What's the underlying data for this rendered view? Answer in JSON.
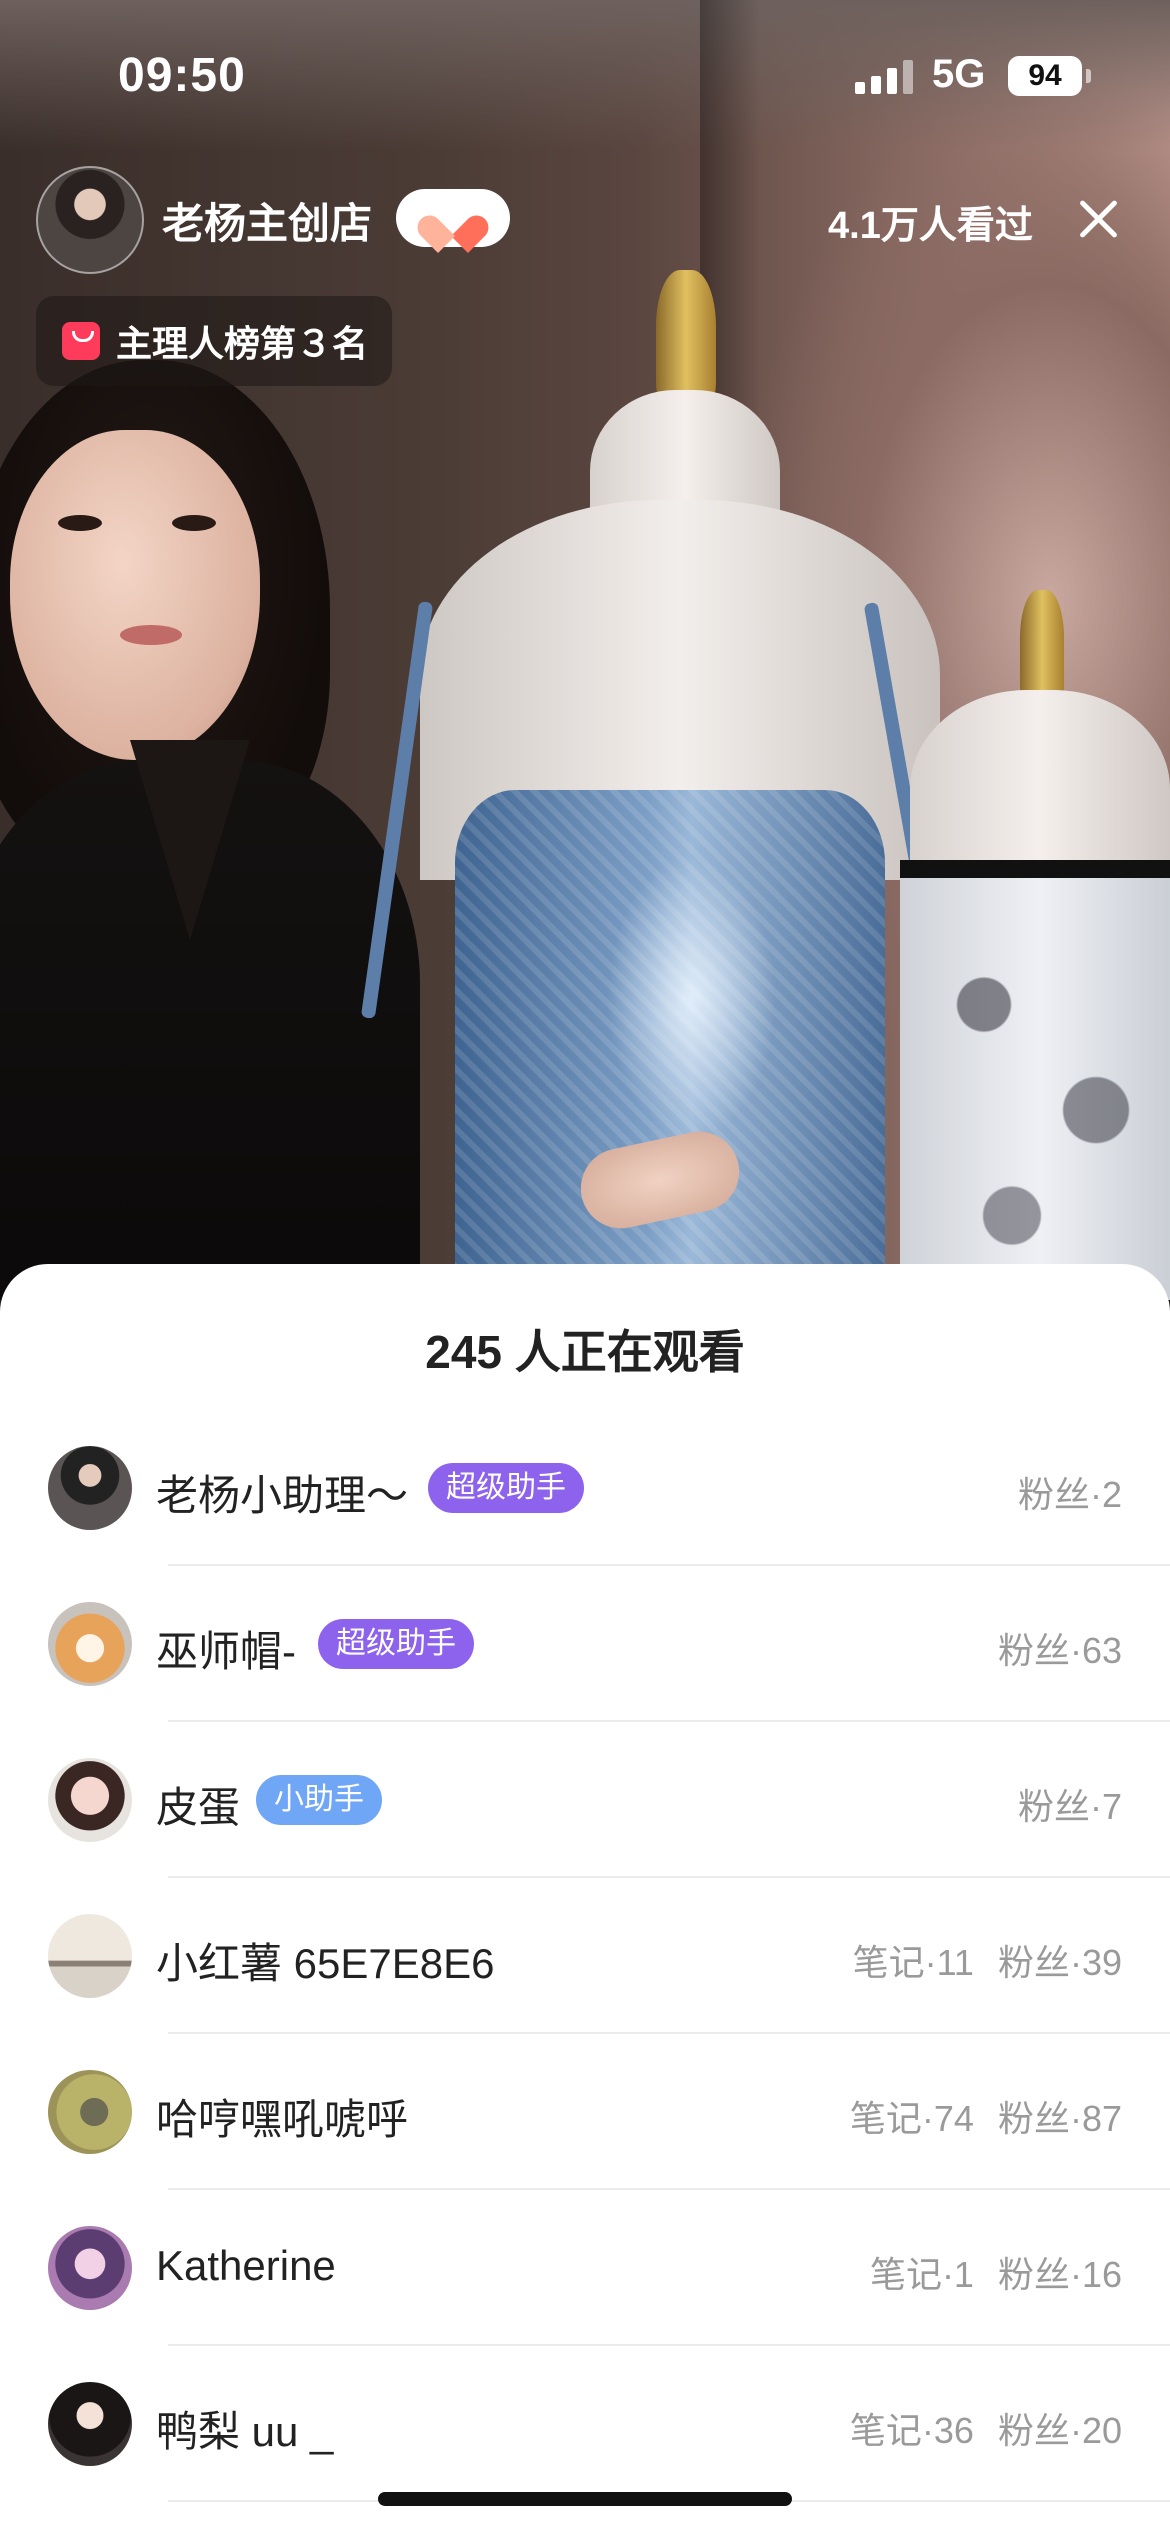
{
  "status_bar": {
    "time": "09:50",
    "network": "5G",
    "battery": "94"
  },
  "live_header": {
    "host_name": "老杨主创店",
    "follow_icon": "heart-icon",
    "view_count": "4.1万人看过",
    "rank_label": "主理人榜第３名"
  },
  "viewer_panel": {
    "title": "245 人正在观看",
    "viewers": [
      {
        "name": "老杨小助理～",
        "badge": "超级助手",
        "badge_type": "super",
        "notes": "",
        "fans": "粉丝·2"
      },
      {
        "name": "巫师帽-",
        "badge": "超级助手",
        "badge_type": "super",
        "notes": "",
        "fans": "粉丝·63"
      },
      {
        "name": "皮蛋",
        "badge": "小助手",
        "badge_type": "small",
        "notes": "",
        "fans": "粉丝·7"
      },
      {
        "name": "小红薯 65E7E8E6",
        "badge": "",
        "badge_type": "",
        "notes": "笔记·11",
        "fans": "粉丝·39"
      },
      {
        "name": "哈哼嘿吼唬呼",
        "badge": "",
        "badge_type": "",
        "notes": "笔记·74",
        "fans": "粉丝·87"
      },
      {
        "name": "Katherine",
        "badge": "",
        "badge_type": "",
        "notes": "笔记·1",
        "fans": "粉丝·16"
      },
      {
        "name": "鸭梨 uu _",
        "badge": "",
        "badge_type": "",
        "notes": "笔记·36",
        "fans": "粉丝·20"
      }
    ]
  },
  "colors": {
    "super_badge": "#8d63ee",
    "small_badge": "#6fa6f6",
    "rank_bag": "#ff3b5c"
  }
}
